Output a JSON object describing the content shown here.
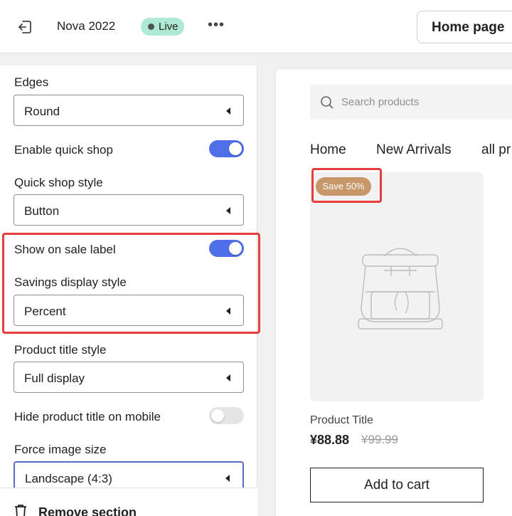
{
  "topbar": {
    "theme_name": "Nova 2022",
    "status_badge": "Live",
    "more_label": "•••",
    "page_selector": "Home page"
  },
  "settings": {
    "edges": {
      "label": "Edges",
      "value": "Round"
    },
    "enable_quick_shop": {
      "label": "Enable quick shop",
      "enabled": true
    },
    "quick_shop_style": {
      "label": "Quick shop style",
      "value": "Button"
    },
    "show_on_sale_label": {
      "label": "Show on sale label",
      "enabled": true
    },
    "savings_display_style": {
      "label": "Savings display style",
      "value": "Percent"
    },
    "product_title_style": {
      "label": "Product title style",
      "value": "Full display"
    },
    "hide_product_title_on_mobile": {
      "label": "Hide product title on mobile",
      "enabled": false
    },
    "force_image_size": {
      "label": "Force image size",
      "value": "Landscape (4:3)"
    },
    "remove_section": "Remove section"
  },
  "preview": {
    "search_placeholder": "Search products",
    "nav": [
      "Home",
      "New Arrivals",
      "all pr"
    ],
    "product": {
      "sale_badge": "Save 50%",
      "title": "Product Title",
      "price": "¥88.88",
      "compare_price": "¥99.99",
      "add_to_cart": "Add to cart"
    }
  },
  "colors": {
    "accent_toggle": "#4f6fe8",
    "highlight": "#e63c3c",
    "live_badge": "#aee9d1",
    "sale_badge": "#c7976a"
  }
}
